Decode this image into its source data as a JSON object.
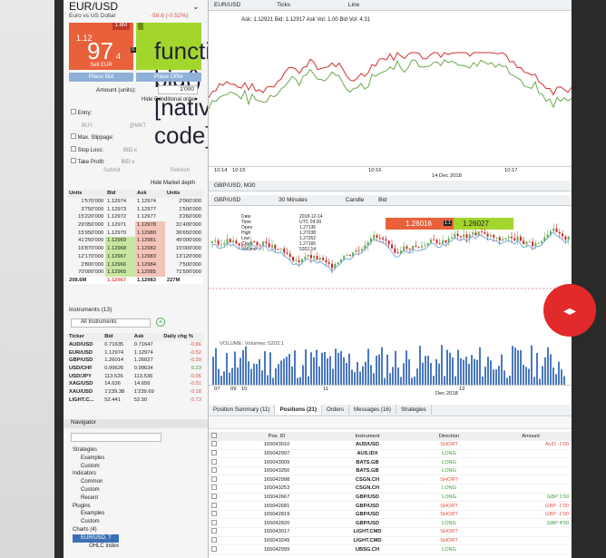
{
  "instrument": {
    "symbol": "EUR/USD",
    "description": "Euro vs US Dollar",
    "change": "-58.6 (-0.52%)",
    "sell": {
      "prefix": "1.12",
      "big": "97",
      "suffix": "4",
      "label": "Sell EUR",
      "volume": "1.8M"
    },
    "buy": "BUY",
    "spread": "0.2",
    "place_bid": "Place Bid",
    "place_offer": "Place Offer",
    "amount_label": "Amount (units):",
    "amount_value": "1'000",
    "hide_conditional": "Hide Conditional order",
    "entry": "Entry:",
    "at_mkt": "@MKT",
    "max_slippage": "Max. Slippage:",
    "stop_loss": "Stop Loss:",
    "take_profit": "Take Profit:",
    "bid_le": "BID ≤",
    "bid_ge": "BID ≥",
    "submit": "Submit",
    "refresh": "Refresh",
    "hide_depth": "Hide Market depth"
  },
  "depth": {
    "headers": [
      "Units",
      "Bid",
      "Ask",
      "Units"
    ],
    "rows": [
      [
        "1'570'000",
        "1.12974",
        "1.12974",
        "2'060'000"
      ],
      [
        "3'750'000",
        "1.12973",
        "1.12977",
        "1'500'000"
      ],
      [
        "15'220'000",
        "1.12972",
        "1.12977",
        "3'260'000"
      ],
      [
        "29'050'000",
        "1.12971",
        "1.12978",
        "31'400'000"
      ],
      [
        "15'950'000",
        "1.12970",
        "1.12980",
        "36'650'000"
      ],
      [
        "41'250'000",
        "1.12969",
        "1.12981",
        "45'000'000"
      ],
      [
        "16'870'000",
        "1.12968",
        "1.12982",
        "15'000'000"
      ],
      [
        "12'170'000",
        "1.12967",
        "1.12983",
        "13'120'000"
      ],
      [
        "2'800'000",
        "1.12966",
        "1.12984",
        "7'500'000"
      ],
      [
        "70'000'000",
        "1.12965",
        "1.12985",
        "71'500'000"
      ]
    ],
    "total": [
      "208.6M",
      "1.12967",
      "1.12983",
      "227M"
    ]
  },
  "instruments": {
    "title": "Instruments (13)",
    "filter": "All Instruments",
    "headers": [
      "Ticker",
      "Bid",
      "Ask",
      "Daily chg %"
    ],
    "rows": [
      [
        "AUD/USD",
        "0.71635",
        "0.71647",
        "-0.86"
      ],
      [
        "EUR/USD",
        "1.12974",
        "1.12974",
        "-0.52"
      ],
      [
        "GBP/USD",
        "1.26014",
        "1.26027",
        "-0.39"
      ],
      [
        "USD/CHF",
        "0.99626",
        "0.99634",
        "0.23"
      ],
      [
        "USD/JPY",
        "113.526",
        "113.536",
        "-0.06"
      ],
      [
        "XAG/USD",
        "14.636",
        "14.656",
        "-0.51"
      ],
      [
        "XAU/USD",
        "1'239.38",
        "1'239.69",
        "-0.18"
      ],
      [
        "LIGHT.C...",
        "52.441",
        "52.50",
        "-0.73"
      ]
    ]
  },
  "navigator": {
    "title": "Navigator",
    "items": [
      "Strategies",
      "Examples",
      "Custom",
      "Indicators",
      "Common",
      "Custom",
      "Recent",
      "Plugins",
      "Examples",
      "Custom",
      "Charts (4)",
      "EUR/USD, T",
      "OHLC Index"
    ]
  },
  "chart1": {
    "symbol": "EUR/USD",
    "type": "Ticks",
    "style": "Line",
    "header": "Ask: 1.12921 Bid: 1.12917 Ask Vol: 1.00 Bid Vol: 4.31",
    "xlabels": [
      "10:14",
      "10:15",
      "10:16",
      "10:17"
    ],
    "date": "14 Dec 2018"
  },
  "chart2": {
    "tab": "GBP/USD, M30",
    "symbol": "GBP/USD",
    "period": "30 Minutes",
    "style": "Candle",
    "side": "Bid",
    "sell": "1.26016",
    "buy": "1.26027",
    "spread": "1.1",
    "info_labels": [
      "Date",
      "Time",
      "Open",
      "High",
      "Low",
      "Close",
      "Volume"
    ],
    "info_values": [
      "2018-12-14",
      "UTC 09:30",
      "1.27136",
      "1.27038",
      "1.27262",
      "1.27165",
      "5202.14"
    ],
    "volume_label": "VOLUME: Volumes: 5203.1",
    "xlabels": [
      "07",
      "09",
      "10",
      "11",
      "12"
    ],
    "date": "Dec 2018"
  },
  "bottom_tabs": [
    "Position Summary (11)",
    "Positions (21)",
    "Orders",
    "Messages (16)",
    "Strategies"
  ],
  "positions": {
    "headers": [
      "Pos. ID",
      "Instrument",
      "Direction",
      "Amount"
    ],
    "rows": [
      [
        "165043010",
        "AUD/USD",
        "SHORT",
        "AUD -1'00"
      ],
      [
        "165042997",
        "AUS.IDX",
        "LONG",
        ""
      ],
      [
        "165043009",
        "BATS.GB",
        "LONG",
        ""
      ],
      [
        "165043250",
        "BATS.GB",
        "LONG",
        ""
      ],
      [
        "165042998",
        "CSGN.CH",
        "SHORT",
        ""
      ],
      [
        "165043253",
        "CSGN.CH",
        "LONG",
        ""
      ],
      [
        "165042667",
        "GBP/USD",
        "LONG",
        "GBP 1'00"
      ],
      [
        "165042681",
        "GBP/USD",
        "SHORT",
        "GBP -1'00"
      ],
      [
        "165042819",
        "GBP/USD",
        "SHORT",
        "GBP -1'00"
      ],
      [
        "165042820",
        "GBP/USD",
        "LONG",
        "GBP 4'00"
      ],
      [
        "165043017",
        "LIGHT.CMD",
        "SHORT",
        ""
      ],
      [
        "165043249",
        "LIGHT.CMD",
        "SHORT",
        ""
      ],
      [
        "165042999",
        "UBSG.CH",
        "LONG",
        ""
      ]
    ]
  },
  "colors": {
    "sell": "#e9613a",
    "buy": "#a3d62d",
    "accent": "#d32f2f"
  }
}
